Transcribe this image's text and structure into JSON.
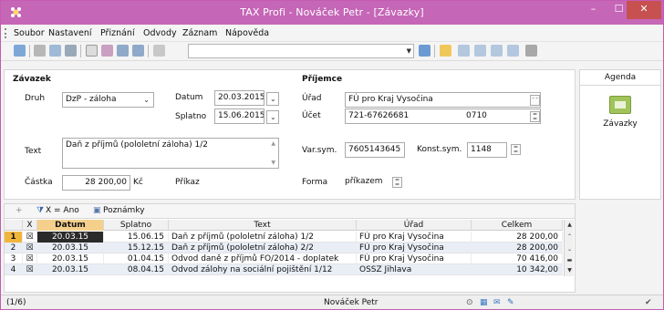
{
  "window": {
    "title": "TAX Profi - Nováček Petr - [Závazky]",
    "accent": "#c566b7",
    "min_glyph": "–",
    "max_glyph": "☐",
    "close_glyph": "✕"
  },
  "menu": {
    "items": [
      "Soubor",
      "Nastavení",
      "Přiznání",
      "Odvody",
      "Záznam",
      "Nápověda"
    ]
  },
  "form": {
    "section_left": "Závazek",
    "section_right": "Příjemce",
    "druh_label": "Druh",
    "druh_value": "DzP - záloha",
    "datum_label": "Datum",
    "datum_value": "20.03.2015",
    "splatno_label": "Splatno",
    "splatno_value": "15.06.2015",
    "text_label": "Text",
    "text_value": "Daň z příjmů (pololetní záloha) 1/2",
    "castka_label": "Částka",
    "castka_value": "28 200,00",
    "currency": "Kč",
    "prikaz_label": "Příkaz",
    "urad_label": "Úřad",
    "urad_value": "FÚ pro Kraj Vysočina",
    "ucet_label": "Účet",
    "ucet_value": "721-67626681",
    "ucet_bank": "0710",
    "varsym_label": "Var.sym.",
    "varsym_value": "7605143645",
    "konstsym_label": "Konst.sym.",
    "konstsym_value": "1148",
    "forma_label": "Forma",
    "forma_value": "příkazem"
  },
  "agenda": {
    "header": "Agenda",
    "item": "Závazky",
    "icon": "ledger-icon"
  },
  "grid": {
    "filter_tab": "X = Ano",
    "notes_tab": "Poznámky",
    "columns": [
      "X",
      "Datum",
      "Splatno",
      "Text",
      "Úřad",
      "Celkem"
    ],
    "rows": [
      {
        "n": "1",
        "x": "☒",
        "datum": "20.03.15",
        "splatno": "15.06.15",
        "text": "Daň z příjmů (pololetní záloha) 1/2",
        "urad": "FÚ pro Kraj Vysočina",
        "celkem": "28 200,00"
      },
      {
        "n": "2",
        "x": "☒",
        "datum": "20.03.15",
        "splatno": "15.12.15",
        "text": "Daň z příjmů (pololetní záloha) 2/2",
        "urad": "FÚ pro Kraj Vysočina",
        "celkem": "28 200,00"
      },
      {
        "n": "3",
        "x": "☒",
        "datum": "20.03.15",
        "splatno": "01.04.15",
        "text": "Odvod daně z příjmů FO/2014 - doplatek",
        "urad": "FÚ pro Kraj Vysočina",
        "celkem": "70 416,00"
      },
      {
        "n": "4",
        "x": "☒",
        "datum": "20.03.15",
        "splatno": "08.04.15",
        "text": "Odvod zálohy na sociální pojištění 1/12",
        "urad": "OSSZ Jihlava",
        "celkem": "10 342,00"
      }
    ]
  },
  "status": {
    "record": "(1/6)",
    "user": "Nováček Petr"
  }
}
